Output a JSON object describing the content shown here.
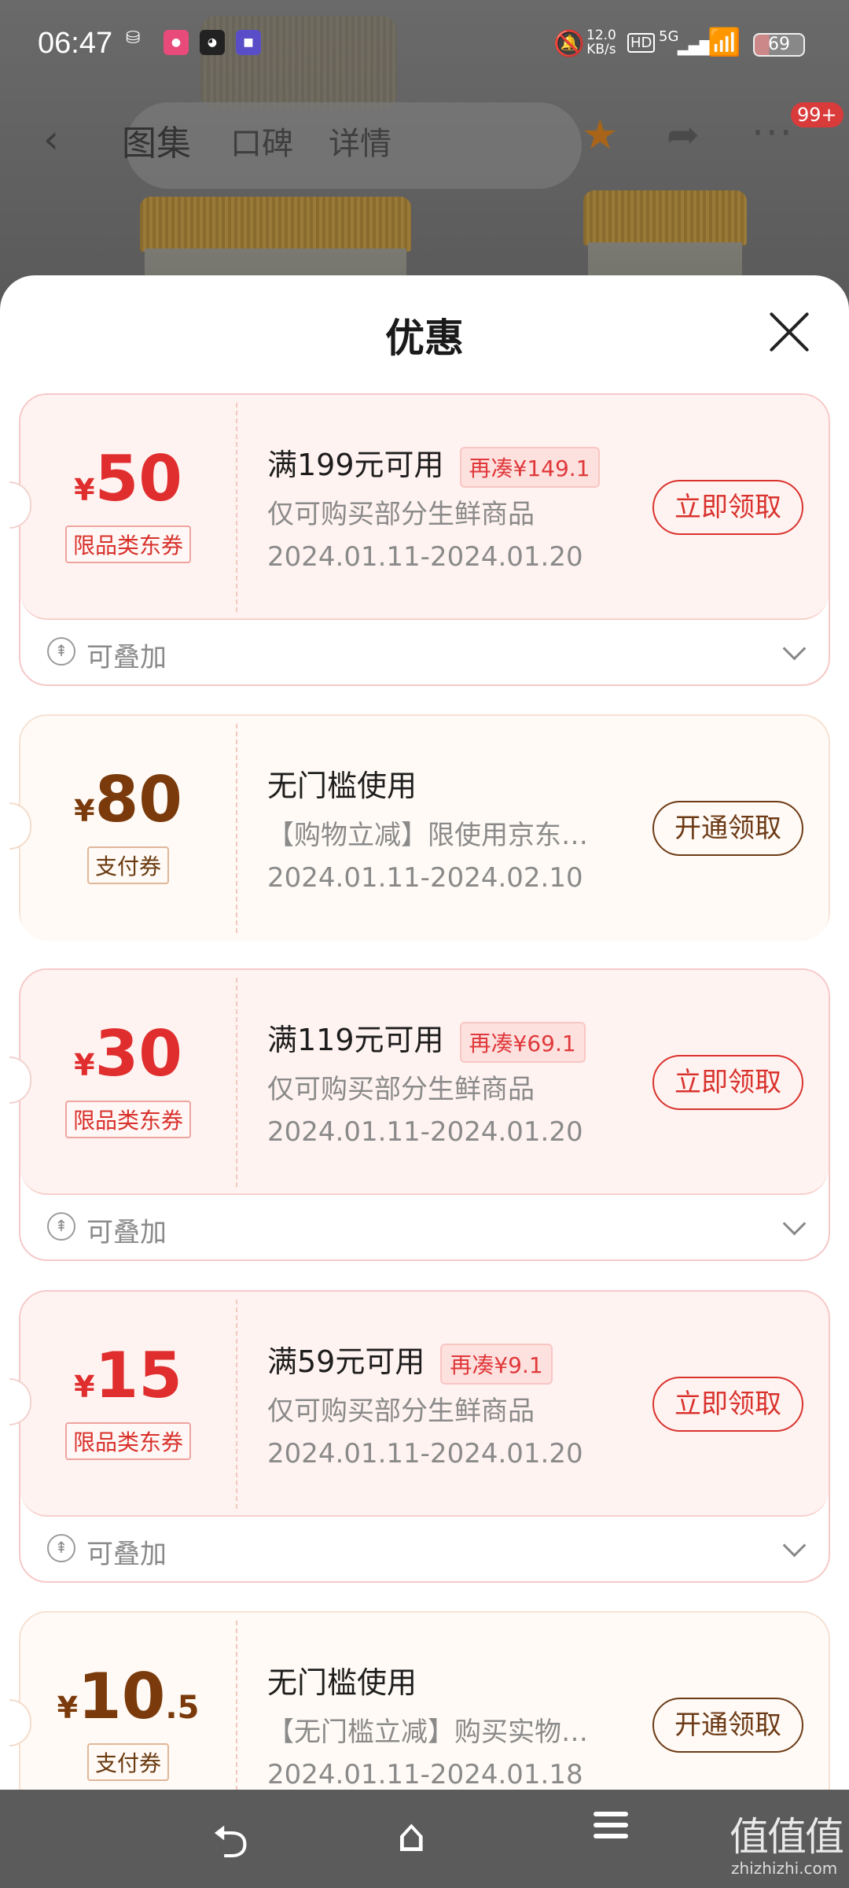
{
  "status_bar": {
    "time": "06:47",
    "network_speed": "12.0",
    "network_unit": "KB/s",
    "hd": "HD",
    "signal": "5G",
    "battery": "69"
  },
  "product_nav": {
    "tabs": [
      "图集",
      "口碑",
      "详情"
    ],
    "badge": "99+"
  },
  "sheet": {
    "title": "优惠"
  },
  "coupons": [
    {
      "style": "red",
      "currency": "¥",
      "amount": "50",
      "amount_decimal": "",
      "tag": "限品类东券",
      "condition": "满199元可用",
      "extra": "再凑¥149.1",
      "description": "仅可购买部分生鲜商品",
      "validity": "2024.01.11-2024.01.20",
      "action": "立即领取",
      "stack_label": "可叠加"
    },
    {
      "style": "gold",
      "currency": "¥",
      "amount": "80",
      "amount_decimal": "",
      "tag": "支付券",
      "condition": "无门槛使用",
      "extra": "",
      "description": "【购物立减】限使用京东…",
      "validity": "2024.01.11-2024.02.10",
      "action": "开通领取",
      "stack_label": ""
    },
    {
      "style": "red",
      "currency": "¥",
      "amount": "30",
      "amount_decimal": "",
      "tag": "限品类东券",
      "condition": "满119元可用",
      "extra": "再凑¥69.1",
      "description": "仅可购买部分生鲜商品",
      "validity": "2024.01.11-2024.01.20",
      "action": "立即领取",
      "stack_label": "可叠加"
    },
    {
      "style": "red",
      "currency": "¥",
      "amount": "15",
      "amount_decimal": "",
      "tag": "限品类东券",
      "condition": "满59元可用",
      "extra": "再凑¥9.1",
      "description": "仅可购买部分生鲜商品",
      "validity": "2024.01.11-2024.01.20",
      "action": "立即领取",
      "stack_label": "可叠加"
    },
    {
      "style": "gold",
      "currency": "¥",
      "amount": "10",
      "amount_decimal": ".5",
      "tag": "支付券",
      "condition": "无门槛使用",
      "extra": "",
      "description": "【无门槛立减】购买实物…",
      "validity": "2024.01.11-2024.01.18",
      "action": "开通领取",
      "stack_label": ""
    }
  ],
  "watermark": {
    "text": "值值值",
    "url": "zhizhizhi.com"
  },
  "colors": {
    "coupon_red": "#e02d2d",
    "coupon_gold": "#7a3a0b",
    "extra_bg": "#fde1df"
  }
}
